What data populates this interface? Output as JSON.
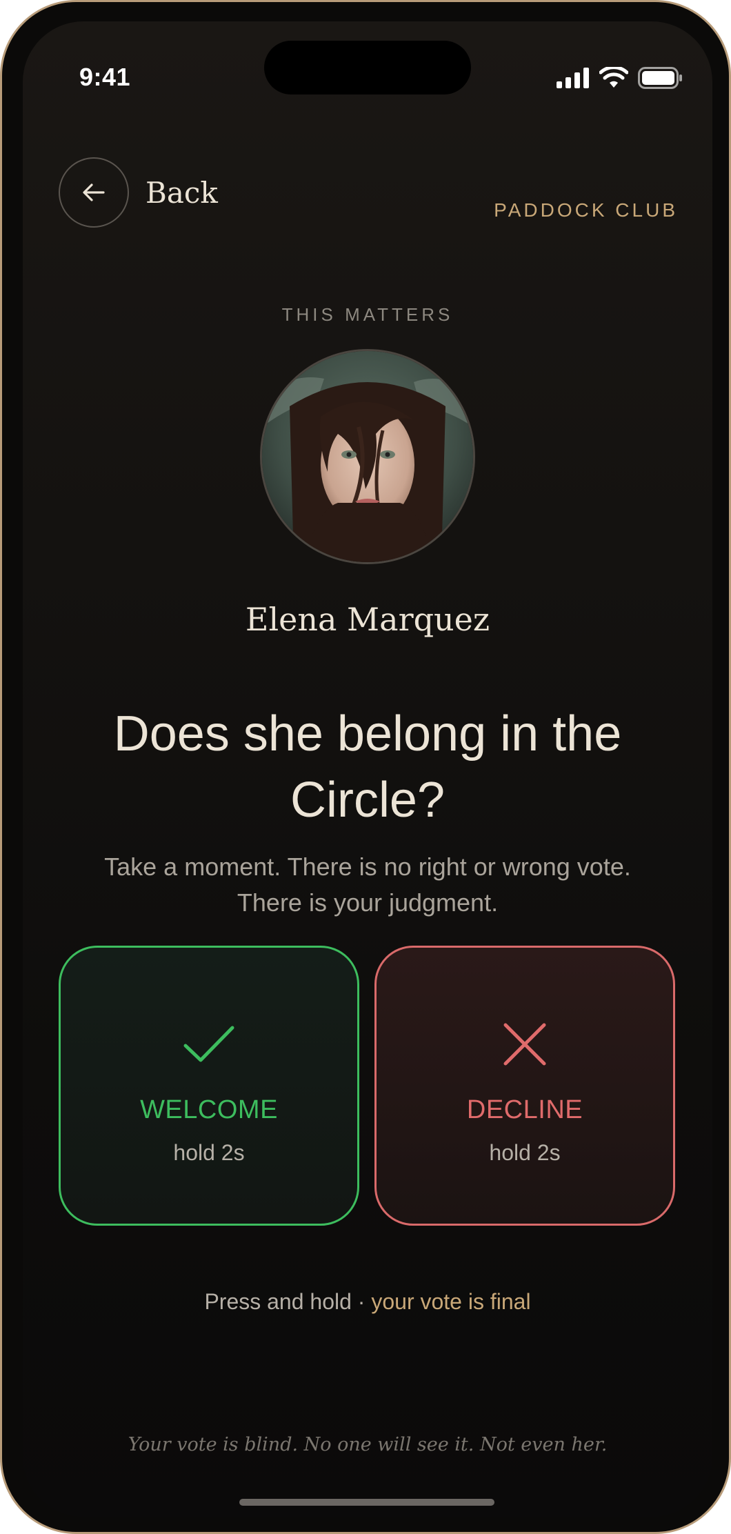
{
  "status_bar": {
    "time": "9:41",
    "icons": [
      "signal-icon",
      "wifi-icon",
      "battery-icon"
    ]
  },
  "header": {
    "back_label": "Back",
    "back_icon": "arrow-left-icon",
    "brand": "PADDOCK CLUB"
  },
  "profile": {
    "eyebrow": "THIS MATTERS",
    "name": "Elena Marquez"
  },
  "prompt": {
    "question": "Does she belong in the Circle?",
    "subtitle_line1": "Take a moment. There is no right or wrong vote.",
    "subtitle_line2": "There is your judgment."
  },
  "votes": {
    "welcome": {
      "icon": "check-icon",
      "label": "WELCOME",
      "hint": "hold 2s",
      "color": "#3dbd5e"
    },
    "decline": {
      "icon": "x-icon",
      "label": "DECLINE",
      "hint": "hold 2s",
      "color": "#e06b6b"
    }
  },
  "instructions": {
    "press_text": "Press and hold · ",
    "press_accent": "your vote is final"
  },
  "footer": {
    "note": "Your vote is blind. No one will see it. Not even her."
  },
  "colors": {
    "accent_gold": "#c9a878",
    "text_primary": "#ece4d6",
    "background": "#141210"
  }
}
